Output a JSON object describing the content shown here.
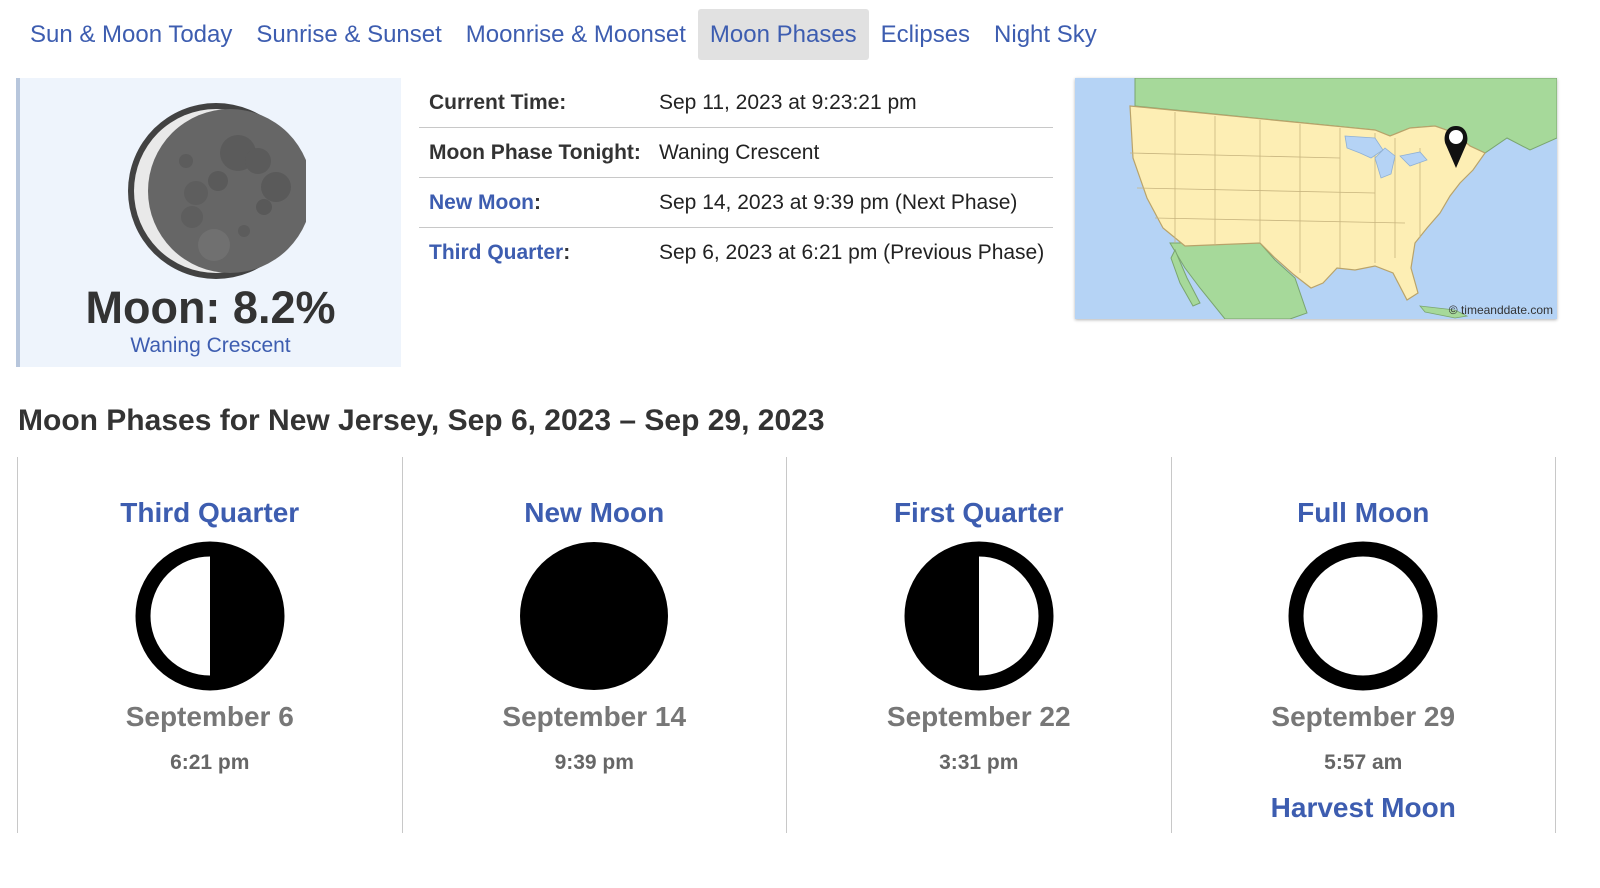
{
  "nav": {
    "items": [
      {
        "label": "Sun & Moon Today"
      },
      {
        "label": "Sunrise & Sunset"
      },
      {
        "label": "Moonrise & Moonset"
      },
      {
        "label": "Moon Phases"
      },
      {
        "label": "Eclipses"
      },
      {
        "label": "Night Sky"
      }
    ],
    "active": "Moon Phases"
  },
  "moon": {
    "illumination_text": "Moon: 8.2%",
    "illumination_percent": 8.2,
    "phase_name": "Waning Crescent"
  },
  "info": {
    "current_time_label": "Current Time:",
    "current_time_value": "Sep 11, 2023 at 9:23:21 pm",
    "phase_tonight_label": "Moon Phase Tonight:",
    "phase_tonight_value": "Waning Crescent",
    "next_label": "New Moon",
    "next_value": "Sep 14, 2023 at 9:39 pm (Next Phase)",
    "prev_label": "Third Quarter",
    "prev_value": "Sep 6, 2023 at 6:21 pm (Previous Phase)"
  },
  "map": {
    "credit": "© timeanddate.com",
    "marker_icon": "location-pin-icon"
  },
  "section_title": "Moon Phases for New Jersey, Sep 6, 2023 – Sep 29, 2023",
  "phases": [
    {
      "name": "Third Quarter",
      "date": "September 6",
      "time": "6:21 pm",
      "extra": "",
      "icon": "third-quarter-icon"
    },
    {
      "name": "New Moon",
      "date": "September 14",
      "time": "9:39 pm",
      "extra": "",
      "icon": "new-moon-icon"
    },
    {
      "name": "First Quarter",
      "date": "September 22",
      "time": "3:31 pm",
      "extra": "",
      "icon": "first-quarter-icon"
    },
    {
      "name": "Full Moon",
      "date": "September 29",
      "time": "5:57 am",
      "extra": "Harvest Moon",
      "icon": "full-moon-icon"
    }
  ],
  "colors": {
    "link": "#3d5db0",
    "nav_active_bg": "#e1e1e1",
    "card_bg": "#eef4fc",
    "map_water": "#b5d3f5",
    "map_land_us": "#fdeeb4",
    "map_land_other": "#a6d99a"
  }
}
